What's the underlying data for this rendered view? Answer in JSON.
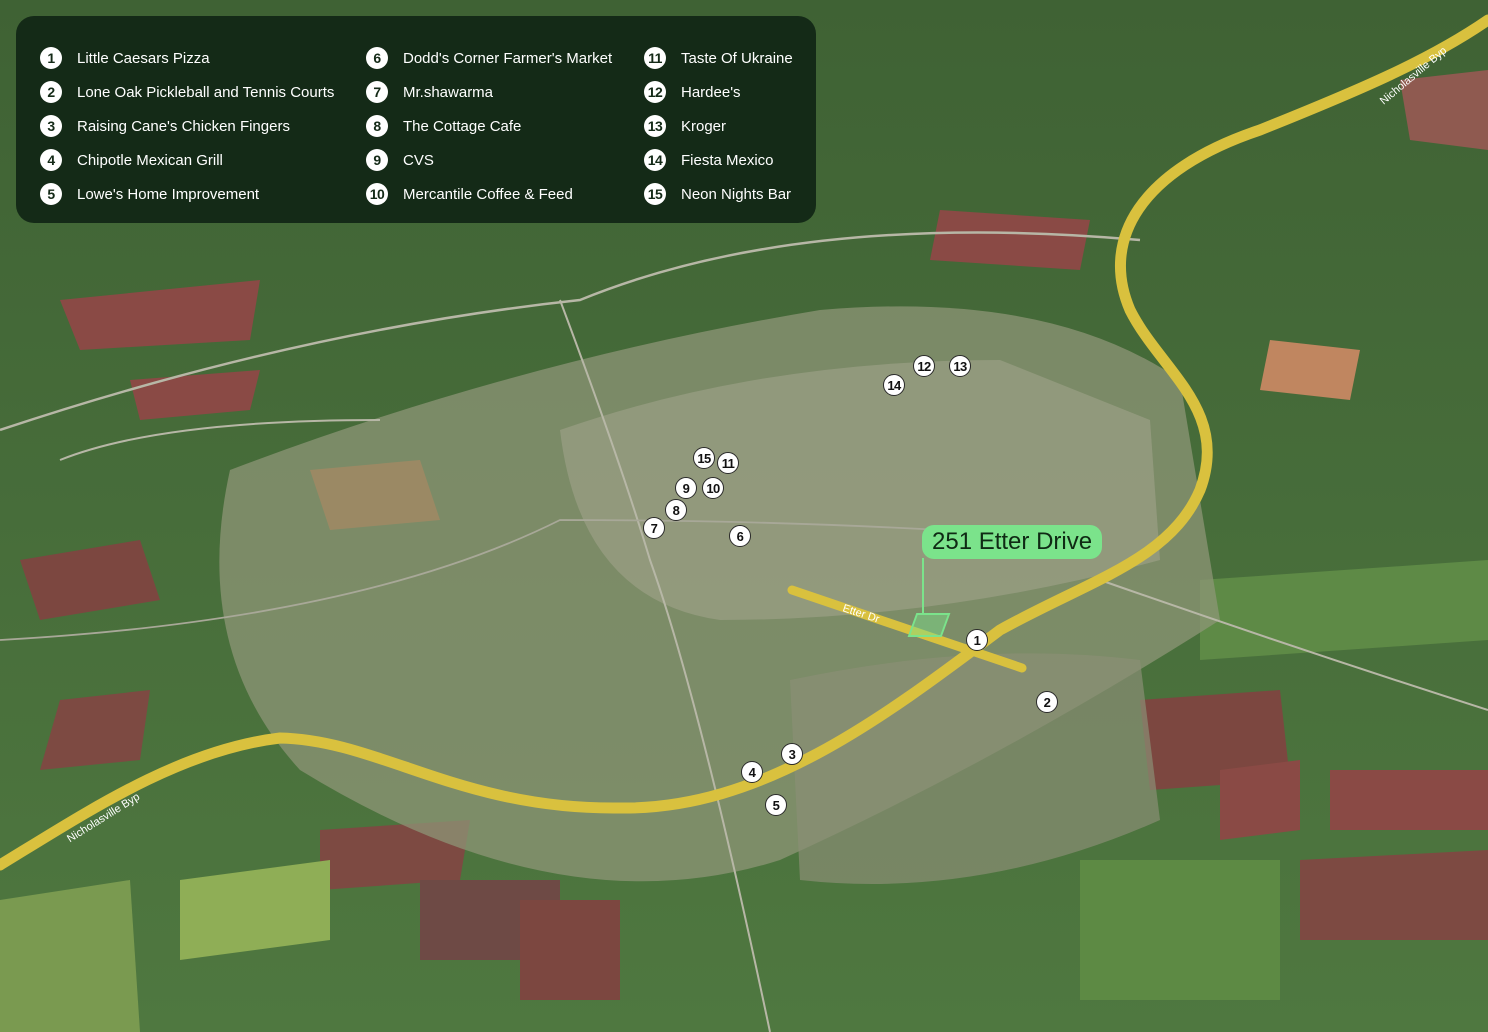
{
  "legend": {
    "items": [
      {
        "n": "1",
        "name": "Little Caesars Pizza"
      },
      {
        "n": "2",
        "name": "Lone Oak Pickleball and Tennis Courts"
      },
      {
        "n": "3",
        "name": "Raising Cane's Chicken Fingers"
      },
      {
        "n": "4",
        "name": "Chipotle Mexican Grill"
      },
      {
        "n": "5",
        "name": "Lowe's Home Improvement"
      },
      {
        "n": "6",
        "name": "Dodd's Corner Farmer's Market"
      },
      {
        "n": "7",
        "name": "Mr.shawarma"
      },
      {
        "n": "8",
        "name": "The Cottage Cafe"
      },
      {
        "n": "9",
        "name": "CVS"
      },
      {
        "n": "10",
        "name": "Mercantile Coffee & Feed"
      },
      {
        "n": "11",
        "name": "Taste Of Ukraine"
      },
      {
        "n": "12",
        "name": "Hardee's"
      },
      {
        "n": "13",
        "name": "Kroger"
      },
      {
        "n": "14",
        "name": "Fiesta Mexico"
      },
      {
        "n": "15",
        "name": "Neon Nights Bar"
      }
    ]
  },
  "markers": [
    "1",
    "2",
    "3",
    "4",
    "5",
    "6",
    "7",
    "8",
    "9",
    "10",
    "11",
    "12",
    "13",
    "14",
    "15"
  ],
  "callout": {
    "label": "251 Etter Drive",
    "color": "#7be38b"
  },
  "roads": {
    "bypass_name": "Nicholasville Byp",
    "street_name": "Etter Dr",
    "bypass_color": "#d9c13e"
  },
  "colors": {
    "legend_bg": "#142a17"
  }
}
